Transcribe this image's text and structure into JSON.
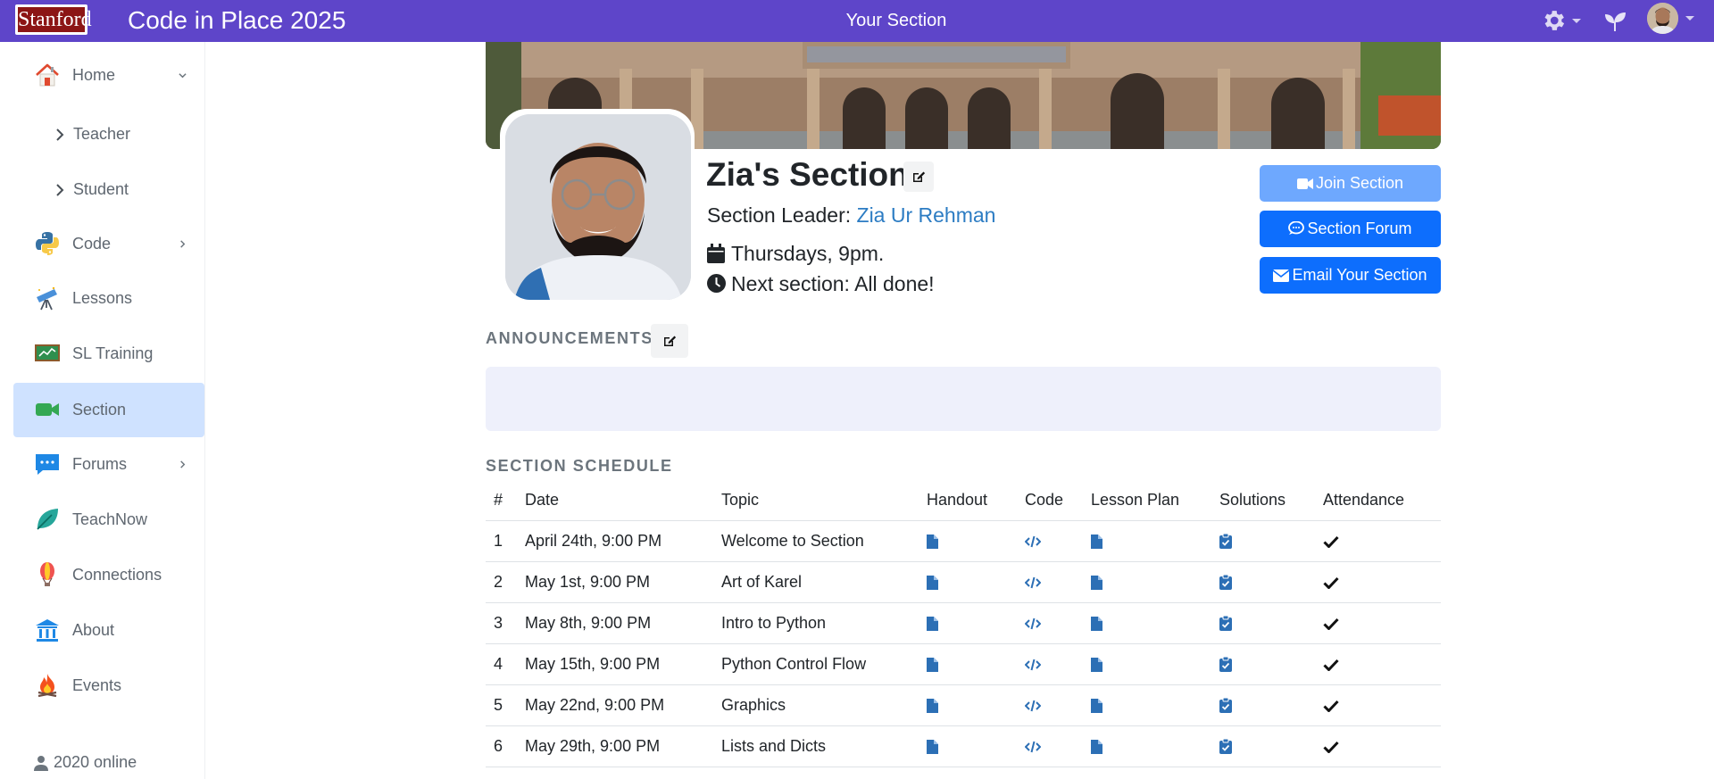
{
  "header": {
    "logo_text": "Stanford",
    "app_title": "Code in Place 2025",
    "page_title": "Your Section"
  },
  "sidebar": {
    "items": [
      {
        "label": "Home"
      },
      {
        "label": "Teacher"
      },
      {
        "label": "Student"
      },
      {
        "label": "Code"
      },
      {
        "label": "Lessons"
      },
      {
        "label": "SL Training"
      },
      {
        "label": "Section"
      },
      {
        "label": "Forums"
      },
      {
        "label": "TeachNow"
      },
      {
        "label": "Connections"
      },
      {
        "label": "About"
      },
      {
        "label": "Events"
      }
    ],
    "active_item": "Section",
    "online_count": "2020 online"
  },
  "section": {
    "title": "Zia's Section",
    "leader_prefix": "Section Leader: ",
    "leader_name": "Zia Ur Rehman",
    "meeting_time": "Thursdays, 9pm.",
    "next_section": "Next section: All done!"
  },
  "actions": {
    "join": "Join Section",
    "forum": "Section Forum",
    "email": "Email Your Section"
  },
  "announcements": {
    "heading": "ANNOUNCEMENTS"
  },
  "schedule": {
    "heading": "SECTION SCHEDULE",
    "columns": [
      "#",
      "Date",
      "Topic",
      "Handout",
      "Code",
      "Lesson Plan",
      "Solutions",
      "Attendance"
    ],
    "rows": [
      {
        "num": "1",
        "date": "April 24th, 9:00 PM",
        "topic": "Welcome to Section"
      },
      {
        "num": "2",
        "date": "May 1st, 9:00 PM",
        "topic": "Art of Karel"
      },
      {
        "num": "3",
        "date": "May 8th, 9:00 PM",
        "topic": "Intro to Python"
      },
      {
        "num": "4",
        "date": "May 15th, 9:00 PM",
        "topic": "Python Control Flow"
      },
      {
        "num": "5",
        "date": "May 22nd, 9:00 PM",
        "topic": "Graphics"
      },
      {
        "num": "6",
        "date": "May 29th, 9:00 PM",
        "topic": "Lists and Dicts"
      }
    ]
  },
  "colors": {
    "header_bg": "#5e45c9",
    "accent_blue": "#0d6efd",
    "link_blue": "#2c7cc3",
    "active_nav_bg": "#cfe2ff"
  },
  "icons": {
    "settings": "gear-icon",
    "sprout": "sprout-icon",
    "calendar": "calendar-icon",
    "clock": "clock-icon",
    "edit": "edit-icon",
    "handout": "file-icon",
    "code": "code-icon",
    "lesson_plan": "file-icon",
    "solutions": "clipboard-check-icon",
    "attendance": "check-icon"
  }
}
